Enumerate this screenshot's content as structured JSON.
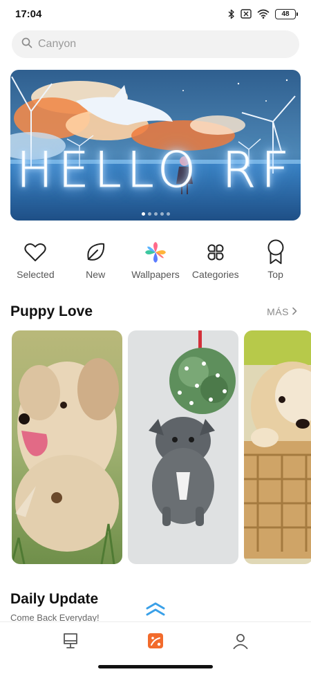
{
  "status_bar": {
    "time": "17:04",
    "battery": "48",
    "icons": [
      "bluetooth-icon",
      "no-sim-icon",
      "wifi-icon",
      "battery-icon"
    ]
  },
  "search": {
    "placeholder": "Canyon"
  },
  "banner": {
    "title": "HELLO RF",
    "slide_count": 5,
    "active_slide": 1
  },
  "quick_nav": {
    "items": [
      {
        "label": "Selected",
        "icon": "heart-icon"
      },
      {
        "label": "New",
        "icon": "leaf-icon"
      },
      {
        "label": "Wallpapers",
        "icon": "pinwheel-icon"
      },
      {
        "label": "Categories",
        "icon": "clover-grid-icon"
      },
      {
        "label": "Top",
        "icon": "ribbon-award-icon"
      }
    ]
  },
  "section": {
    "title": "Puppy Love",
    "more": "MÁS"
  },
  "cards": [
    {
      "subject": "fluffy dog"
    },
    {
      "subject": "french bulldog with mistletoe"
    },
    {
      "subject": "puppy in basket"
    }
  ],
  "daily": {
    "title": "Daily Update",
    "subtitle": "Come Back Everyday!"
  },
  "bottom_nav": {
    "items": [
      {
        "icon": "kiosk-icon"
      },
      {
        "icon": "wallpaper-app-icon",
        "active": true
      },
      {
        "icon": "profile-icon"
      }
    ]
  },
  "colors": {
    "accent": "#f26b2c",
    "scroll_top": "#3aa0e8",
    "text_primary": "#111111",
    "text_secondary": "#555555"
  }
}
